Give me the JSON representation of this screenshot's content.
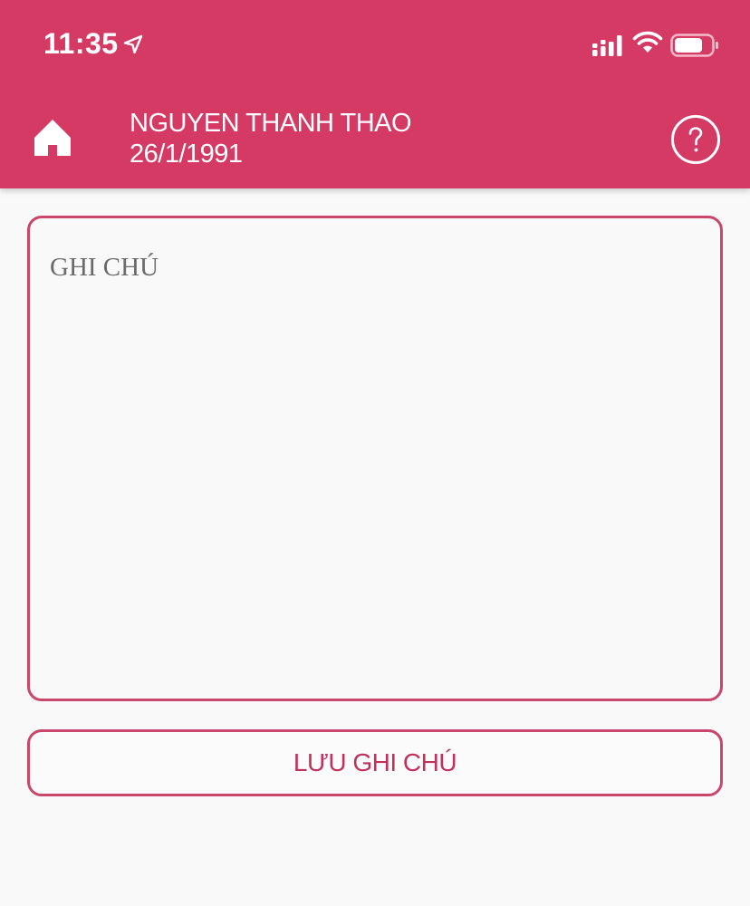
{
  "status_bar": {
    "time": "11:35",
    "icons": [
      "location-arrow-icon",
      "cellular-signal-icon",
      "wifi-icon",
      "battery-icon"
    ]
  },
  "header": {
    "home_icon": "home-icon",
    "patient_name": "NGUYEN THANH THAO",
    "patient_dob": "26/1/1991",
    "help_icon": "question-circle-icon"
  },
  "note": {
    "value": "",
    "placeholder": "GHI CHÚ"
  },
  "save_button": {
    "label": "LƯU GHI CHÚ"
  },
  "colors": {
    "primary": "#d43a64",
    "border": "#c9466c",
    "button_text": "#c0325c",
    "background": "#f9f9f9"
  }
}
